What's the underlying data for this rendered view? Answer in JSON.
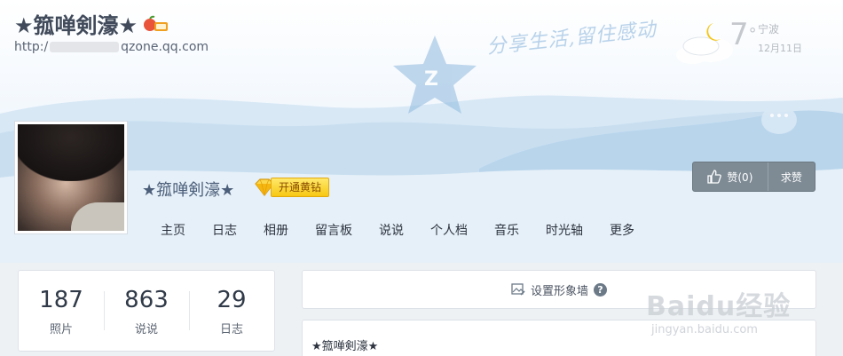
{
  "header": {
    "site_title": "★箛啴剣濠★",
    "url_prefix": "http:/",
    "url_suffix": "qzone.qq.com",
    "slogan": "分享生活,留住感动"
  },
  "weather": {
    "temperature": "7",
    "degree_symbol": "°",
    "city": "宁波",
    "date": "12月11日",
    "icon": "moon-cloud-icon"
  },
  "profile": {
    "name": "★箛啴剣濠★",
    "vip_label": "开通黄钻",
    "like_label": "赞(0)",
    "ask_label": "求赞"
  },
  "nav": {
    "items": [
      {
        "label": "主页"
      },
      {
        "label": "日志"
      },
      {
        "label": "相册"
      },
      {
        "label": "留言板"
      },
      {
        "label": "说说"
      },
      {
        "label": "个人档"
      },
      {
        "label": "音乐"
      },
      {
        "label": "时光轴"
      },
      {
        "label": "更多"
      }
    ]
  },
  "stats": [
    {
      "value": "187",
      "label": "照片"
    },
    {
      "value": "863",
      "label": "说说"
    },
    {
      "value": "29",
      "label": "日志"
    }
  ],
  "wall": {
    "label": "设置形象墙",
    "help": "?"
  },
  "bio": {
    "text": "★箛啴剣濠★"
  },
  "watermark": {
    "brand": "Baidu经验",
    "site": "jingyan.baidu.com"
  },
  "colors": {
    "accent": "#4c5f7a",
    "vip_gold": "#f7c813",
    "like_box": "#7e8b95"
  }
}
